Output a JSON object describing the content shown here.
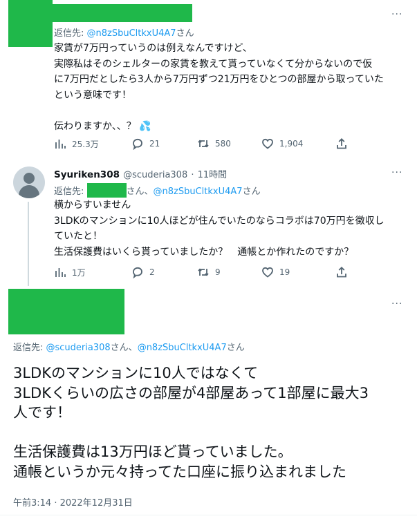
{
  "tweet1": {
    "reply_prefix": "返信先: ",
    "reply_to": "@n8zSbuCltkxU4A7",
    "reply_suffix": "さん",
    "text": "家賃が7万円っていうのは例えなんですけど、\n実際私はそのシェルターの家賃を教えて貰っていなくて分からないので仮\nに7万円だとしたら3人から7万円ずつ21万円をひとつの部屋から取っていた\nという意味です！\n\n伝わりますか、、？",
    "emoji": "💦",
    "views": "25.3万",
    "replies": "21",
    "retweets": "580",
    "likes": "1,904"
  },
  "tweet2": {
    "display_name": "Syuriken308",
    "handle": "@scuderia308",
    "sep": "·",
    "time": "11時間",
    "reply_prefix": "返信先: ",
    "reply_suffix1": "さん、",
    "reply_to2": "@n8zSbuCltkxU4A7",
    "reply_suffix2": "さん",
    "text": "横からすいません\n3LDKのマンションに10人ほどが住んでいたのならコラボは70万円を徴収し\nていたと！\n生活保護費はいくら貰っていましたか？　通帳とか作れたのですか？",
    "views": "1万",
    "replies": "2",
    "retweets": "9",
    "likes": "19"
  },
  "tweet3": {
    "reply_prefix": "返信先: ",
    "reply_to1": "@scuderia308",
    "reply_mid": "さん、",
    "reply_to2": "@n8zSbuCltkxU4A7",
    "reply_suffix": "さん",
    "text": "3LDKのマンションに10人ではなくて\n3LDKくらいの広さの部屋が4部屋あって1部屋に最大3\n人です！\n\n生活保護費は13万円ほど貰っていました。\n通帳というか元々持ってた口座に振り込まれました",
    "timestamp": "午前3:14 · 2022年12月31日"
  },
  "icons": {
    "more": "more-dots-icon",
    "views": "bar-chart-icon",
    "reply": "speech-bubble-icon",
    "retweet": "retweet-icon",
    "like": "heart-icon",
    "share": "share-icon"
  },
  "colors": {
    "accent": "#1d9bf0",
    "secondary_text": "#536471",
    "redaction": "#1fb84a"
  },
  "more_label": "···"
}
